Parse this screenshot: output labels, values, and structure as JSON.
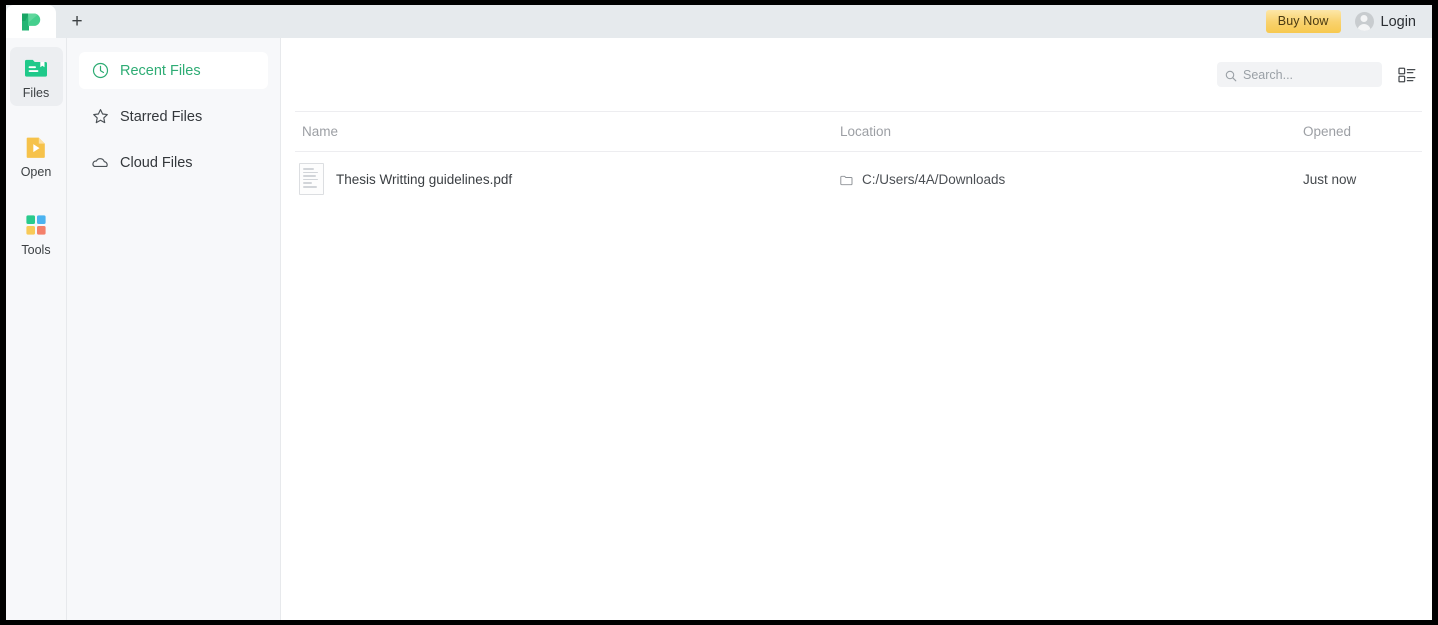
{
  "window": {
    "tab_new_label": "+",
    "buy_now_label": "Buy Now",
    "login_label": "Login"
  },
  "rail": {
    "items": [
      {
        "label": "Files",
        "icon": "files-icon",
        "active": true
      },
      {
        "label": "Open",
        "icon": "open-file-icon",
        "active": false
      },
      {
        "label": "Tools",
        "icon": "tools-grid-icon",
        "active": false
      }
    ]
  },
  "nav": {
    "items": [
      {
        "label": "Recent Files",
        "icon": "clock-icon",
        "active": true
      },
      {
        "label": "Starred Files",
        "icon": "star-icon",
        "active": false
      },
      {
        "label": "Cloud Files",
        "icon": "cloud-icon",
        "active": false
      }
    ]
  },
  "toolbar": {
    "search_placeholder": "Search...",
    "search_value": "",
    "search_icon": "search-icon",
    "view_toggle_icon": "list-view-icon"
  },
  "table": {
    "columns": [
      "Name",
      "Location",
      "Opened"
    ],
    "rows": [
      {
        "name": "Thesis Writting guidelines.pdf",
        "location": "C:/Users/4A/Downloads",
        "opened": "Just now",
        "file_icon": "pdf-document-thumbnail",
        "location_icon": "folder-icon"
      }
    ]
  },
  "colors": {
    "accent_green": "#2eac74",
    "logo_green_light": "#3ecf87",
    "logo_green_dark": "#1fa968",
    "buy_now_gold": "#f7c94f",
    "tabbar_bg": "#e6eaed",
    "panel_bg": "#f7f8fa"
  }
}
